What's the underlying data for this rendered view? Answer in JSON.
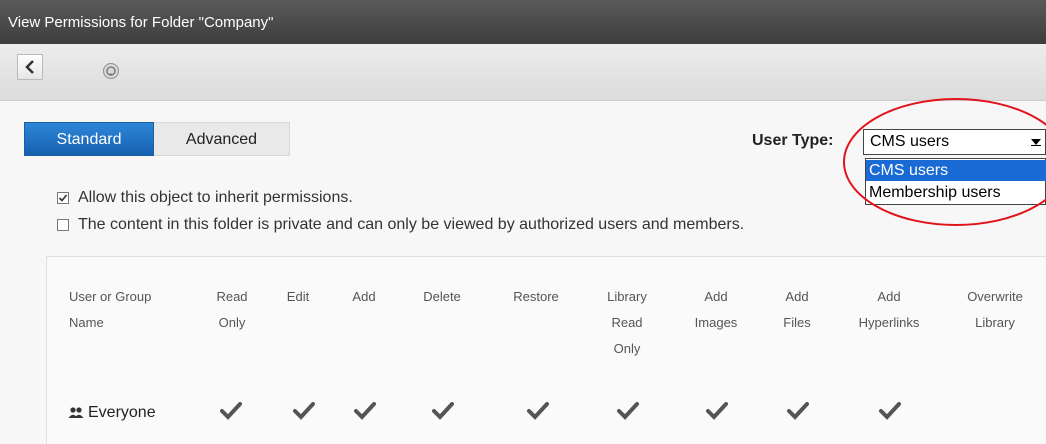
{
  "window": {
    "title": "View Permissions for Folder \"Company\""
  },
  "toolbar": {
    "back_icon": "chevron-left-icon",
    "help_icon": "help-icon"
  },
  "tabs": [
    {
      "label": "Standard",
      "active": true
    },
    {
      "label": "Advanced",
      "active": false
    }
  ],
  "user_type": {
    "label": "User Type:",
    "selected": "CMS users",
    "options": [
      "CMS users",
      "Membership users"
    ],
    "highlighted_option": "CMS users"
  },
  "checkboxes": [
    {
      "label": "Allow this object to inherit permissions.",
      "checked": true
    },
    {
      "label": "The content in this folder is private and can only be viewed by authorized users and members.",
      "checked": false
    }
  ],
  "table": {
    "headers": [
      "User or Group Name",
      "Read Only",
      "Edit",
      "Add",
      "Delete",
      "Restore",
      "Library Read Only",
      "Add Images",
      "Add Files",
      "Add Hyperlinks",
      "Overwrite Library"
    ],
    "rows": [
      {
        "name": "Everyone",
        "icon": "group-icon",
        "permissions": [
          true,
          true,
          true,
          true,
          true,
          true,
          true,
          true,
          true,
          false
        ]
      }
    ]
  },
  "colors": {
    "tab_active": "#1f73c9",
    "dropdown_highlight": "#1a6ad6",
    "annotation_ring": "#e0151b",
    "titlebar": "#4a4a4a"
  }
}
